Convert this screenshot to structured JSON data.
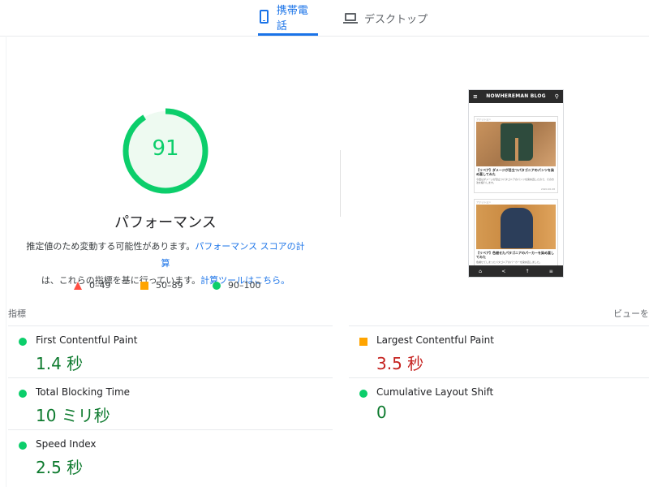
{
  "tabs": {
    "mobile": {
      "label": "携帯電話",
      "icon": "phone-icon"
    },
    "desktop": {
      "label": "デスクトップ",
      "icon": "laptop-icon"
    }
  },
  "performance": {
    "score": "91",
    "score_fraction": 0.91,
    "title": "パフォーマンス",
    "desc_1": "推定値のため変動する可能性があります。",
    "desc_link_1": "パフォーマンス スコアの計算",
    "desc_2": "は、これらの指標を基に行っています。",
    "desc_link_2": "計算ツールはこちら。"
  },
  "legend": [
    {
      "label": "0–49",
      "shape": "triangle",
      "color": "#ff4e42"
    },
    {
      "label": "50–89",
      "shape": "square",
      "color": "#ffa400"
    },
    {
      "label": "90–100",
      "shape": "circle",
      "color": "#0cce6b"
    }
  ],
  "preview": {
    "blog_title": "NOWHEREMAN BLOG",
    "card1": {
      "category": "ファッション",
      "title": "【リペア】ダメージが目立つパタゴニアのパンツを染め直してみた",
      "text": "今回はダメージが目立つパタゴニアのパンツを染め直したので、その方法を紹介します。",
      "date": "2020.06.08"
    },
    "card2": {
      "category": "ファッション",
      "title": "【リペア】色褪せたパタゴニアのパーカーを染め直してみた",
      "text": "色褪せてしまったパタゴニアのパーカーを染め直しました。",
      "date": "2020.06.01"
    }
  },
  "metrics": {
    "header": "指標",
    "view_link": "ビューを",
    "items": {
      "fcp": {
        "name": "First Contentful Paint",
        "value": "1.4 秒",
        "status": "good"
      },
      "lcp": {
        "name": "Largest Contentful Paint",
        "value": "3.5 秒",
        "status": "average"
      },
      "tbt": {
        "name": "Total Blocking Time",
        "value": "10 ミリ秒",
        "status": "good"
      },
      "cls": {
        "name": "Cumulative Layout Shift",
        "value": "0",
        "status": "good"
      },
      "si": {
        "name": "Speed Index",
        "value": "2.5 秒",
        "status": "good"
      }
    }
  },
  "colors": {
    "good": "#0cce6b",
    "good_text": "#0d7a2e",
    "average": "#ffa400",
    "poor": "#ff4e42",
    "link": "#1a73e8"
  }
}
